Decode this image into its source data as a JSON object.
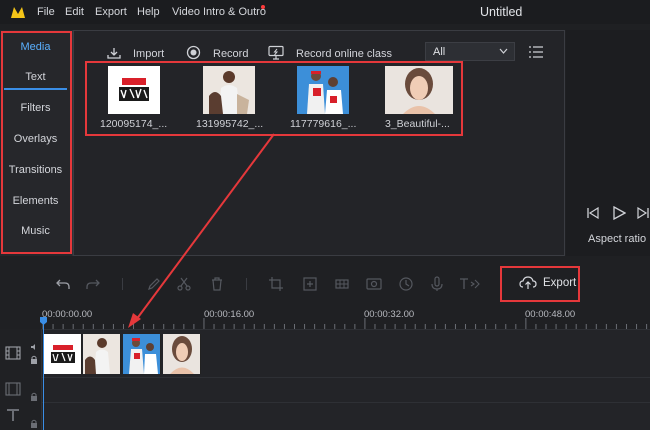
{
  "menubar": {
    "items": [
      "File",
      "Edit",
      "Export",
      "Help",
      "Video Intro & Outro"
    ],
    "title": "Untitled"
  },
  "sidebar": {
    "items": [
      {
        "label": "Media",
        "active": true
      },
      {
        "label": "Text"
      },
      {
        "label": "Filters"
      },
      {
        "label": "Overlays"
      },
      {
        "label": "Transitions"
      },
      {
        "label": "Elements"
      },
      {
        "label": "Music"
      }
    ]
  },
  "media_toolbar": {
    "import_label": "Import",
    "record_label": "Record",
    "record_online_label": "Record online class",
    "filter_value": "All"
  },
  "media_items": [
    {
      "name": "120095174_..."
    },
    {
      "name": "131995742_..."
    },
    {
      "name": "117779616_..."
    },
    {
      "name": "3_Beautiful-..."
    }
  ],
  "preview": {
    "aspect_label": "Aspect ratio"
  },
  "edit_toolbar": {
    "export_label": "Export"
  },
  "timeline": {
    "ticks": [
      "00:00:00.00",
      "00:00:16.00",
      "00:00:32.00",
      "00:00:48.00"
    ]
  },
  "colors": {
    "accent": "#3a8ee6",
    "annotation": "#e5383b",
    "background": "#1f2023"
  }
}
